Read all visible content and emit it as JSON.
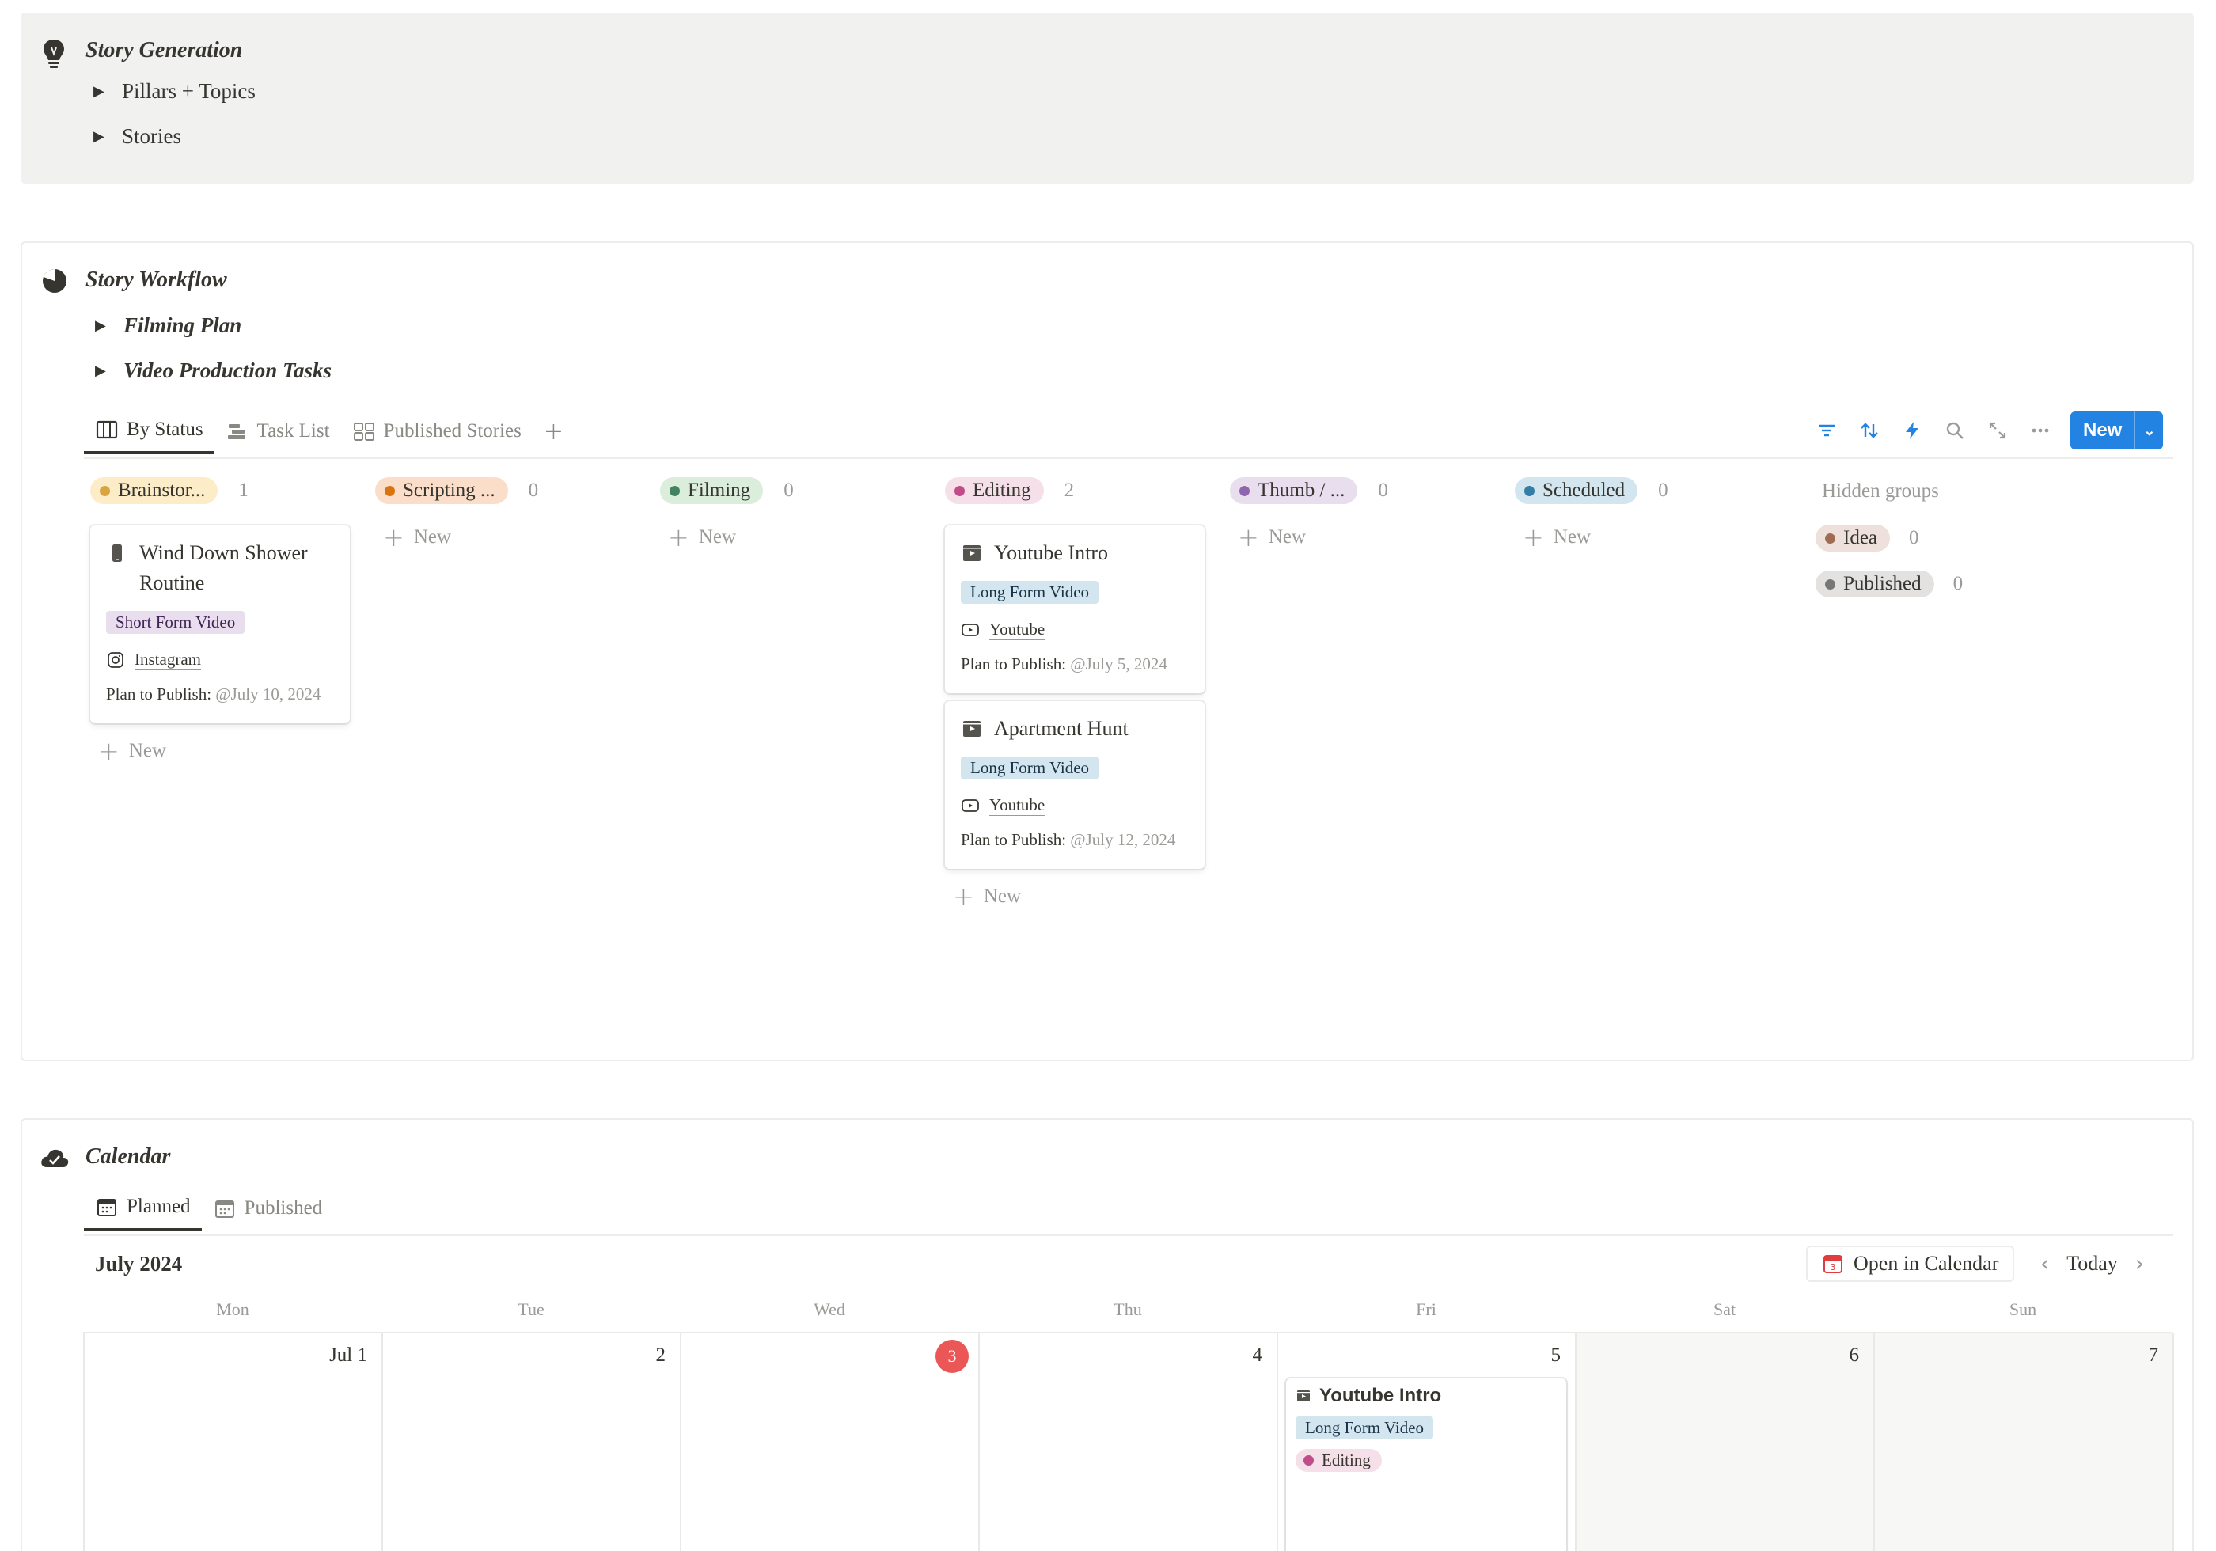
{
  "story_generation": {
    "title": "Story Generation",
    "icon": "lightbulb-icon",
    "toggles": [
      {
        "label": "Pillars + Topics"
      },
      {
        "label": "Stories"
      }
    ]
  },
  "story_workflow": {
    "title": "Story Workflow",
    "icon": "pie-chart-icon",
    "toggles": [
      {
        "label": "Filming Plan"
      },
      {
        "label": "Video Production Tasks"
      }
    ],
    "views": [
      {
        "label": "By Status",
        "icon": "board-icon",
        "active": true
      },
      {
        "label": "Task List",
        "icon": "timeline-icon",
        "active": false
      },
      {
        "label": "Published Stories",
        "icon": "gallery-icon",
        "active": false
      }
    ],
    "add_view": "+",
    "new_button": "New",
    "columns": [
      {
        "label": "Brainstor...",
        "count": "1",
        "bg": "#fdecc8",
        "dot": "#d9a441"
      },
      {
        "label": "Scripting ...",
        "count": "0",
        "bg": "#fadec9",
        "dot": "#d9730d"
      },
      {
        "label": "Filming",
        "count": "0",
        "bg": "#dbeddb",
        "dot": "#448361"
      },
      {
        "label": "Editing",
        "count": "2",
        "bg": "#f5e0e9",
        "dot": "#c14c8a"
      },
      {
        "label": "Thumb / ...",
        "count": "0",
        "bg": "#e8deee",
        "dot": "#9065b0"
      },
      {
        "label": "Scheduled",
        "count": "0",
        "bg": "#d3e5ef",
        "dot": "#337ea9"
      }
    ],
    "new_label": "New",
    "cards": {
      "brainstorm": {
        "title": "Wind Down Shower Routine",
        "tag": "Short Form Video",
        "platform": "Instagram",
        "plan_label": "Plan to Publish:",
        "plan_date": "@July 10, 2024"
      },
      "editing_1": {
        "title": "Youtube Intro",
        "tag": "Long Form Video",
        "platform": "Youtube",
        "plan_label": "Plan to Publish:",
        "plan_date": "@July 5, 2024"
      },
      "editing_2": {
        "title": "Apartment Hunt",
        "tag": "Long Form Video",
        "platform": "Youtube",
        "plan_label": "Plan to Publish:",
        "plan_date": "@July 12, 2024"
      }
    },
    "hidden_groups": {
      "title": "Hidden groups",
      "items": [
        {
          "label": "Idea",
          "count": "0",
          "bg": "#eee0da",
          "dot": "#9f6b53"
        },
        {
          "label": "Published",
          "count": "0",
          "bg": "#e3e2e0",
          "dot": "#787774"
        }
      ]
    }
  },
  "calendar": {
    "title": "Calendar",
    "icon": "cloud-check-icon",
    "views": [
      {
        "label": "Planned",
        "active": true
      },
      {
        "label": "Published",
        "active": false
      }
    ],
    "month": "July 2024",
    "open_in_calendar": "Open in Calendar",
    "today": "Today",
    "weekdays": [
      "Mon",
      "Tue",
      "Wed",
      "Thu",
      "Fri",
      "Sat",
      "Sun"
    ],
    "days": [
      "Jul 1",
      "2",
      "3",
      "4",
      "5",
      "6",
      "7"
    ],
    "today_day": "3",
    "event": {
      "title": "Youtube Intro",
      "tag": "Long Form Video",
      "status": "Editing"
    }
  },
  "colors": {
    "accent": "#2383e2",
    "today": "#eb5757"
  }
}
